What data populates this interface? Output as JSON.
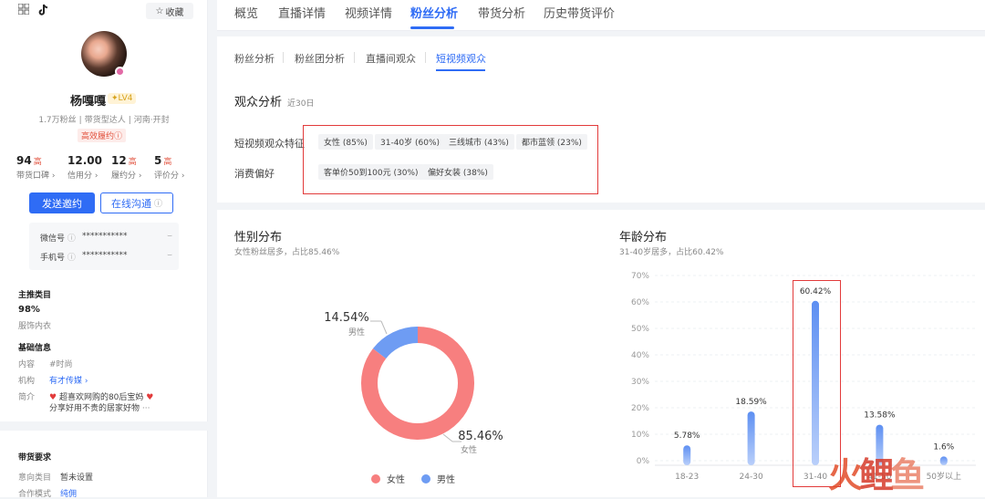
{
  "sidebar": {
    "favorite_label": "收藏",
    "name": "杨嘎嘎",
    "level": "LV4",
    "meta": [
      "1.7万粉丝",
      "带货型达人",
      "河南·开封"
    ],
    "badge": "高效履约",
    "stats": [
      {
        "value": "94",
        "tag": "高",
        "label": "带货口碑"
      },
      {
        "value": "12.00",
        "tag": "",
        "label": "信用分"
      },
      {
        "value": "12",
        "tag": "高",
        "label": "履约分"
      },
      {
        "value": "5",
        "tag": "高",
        "label": "评价分"
      }
    ],
    "invite_button": "发送邀约",
    "chat_button": "在线沟通",
    "wechat_label": "微信号",
    "wechat_value": "***********",
    "phone_label": "手机号",
    "phone_value": "***********",
    "category_title": "主推类目",
    "category_pct": "98%",
    "category_name": "服饰内衣",
    "basic_title": "基础信息",
    "content_label": "内容",
    "content_value": "#时尚",
    "org_label": "机构",
    "org_value": "有才传媒",
    "intro_label": "简介",
    "intro_line1": "超喜欢网购的80后宝妈",
    "intro_line2": "分享好用不贵的居家好物",
    "intro_more": "···",
    "req_title": "带货要求",
    "intent_label": "意向类目",
    "intent_value": "暂未设置",
    "coop_label": "合作模式",
    "coop_value": "纯佣"
  },
  "main_tabs": [
    "概览",
    "直播详情",
    "视频详情",
    "粉丝分析",
    "带货分析",
    "历史带货评价"
  ],
  "sub_tabs": [
    "粉丝分析",
    "粉丝团分析",
    "直播间观众",
    "短视频观众"
  ],
  "audience": {
    "title": "观众分析",
    "period": "近30日",
    "feature_label": "短视频观众特征",
    "features": [
      "女性 (85%)",
      "31-40岁 (60%)",
      "三线城市 (43%)",
      "都市蓝领 (23%)"
    ],
    "consume_label": "消费偏好",
    "consume": [
      "客单价50到100元 (30%)",
      "偏好女装 (38%)"
    ]
  },
  "gender": {
    "title": "性别分布",
    "note": "女性粉丝居多，占比85.46%",
    "legend": [
      "女性",
      "男性"
    ]
  },
  "age": {
    "title": "年龄分布",
    "note": "31-40岁居多，占比60.42%"
  },
  "chart_data": [
    {
      "type": "pie",
      "labels": [
        "女性",
        "男性"
      ],
      "values": [
        85.46,
        14.54
      ],
      "value_labels": [
        "85.46%",
        "14.54%"
      ],
      "colors": [
        "#f77f7f",
        "#6e9cf3"
      ]
    },
    {
      "type": "bar",
      "categories": [
        "18-23",
        "24-30",
        "31-40",
        "41-50",
        "50岁以上"
      ],
      "values": [
        5.78,
        18.59,
        60.42,
        13.58,
        1.6
      ],
      "value_labels": [
        "5.78%",
        "18.59%",
        "60.42%",
        "13.58%",
        "1.6%"
      ],
      "y_ticks": [
        "0%",
        "10%",
        "20%",
        "30%",
        "40%",
        "50%",
        "60%",
        "70%"
      ],
      "ylim": [
        0,
        70
      ],
      "color": "#6e9cf3"
    }
  ],
  "watermark": "火鲤鱼"
}
